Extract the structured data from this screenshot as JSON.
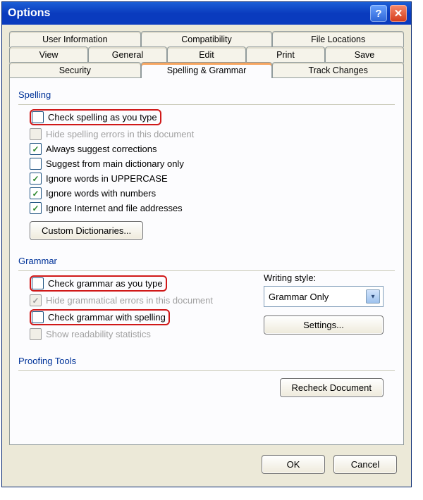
{
  "window": {
    "title": "Options"
  },
  "tabs": {
    "row1": [
      "User Information",
      "Compatibility",
      "File Locations"
    ],
    "row2": [
      "View",
      "General",
      "Edit",
      "Print",
      "Save"
    ],
    "row3": [
      "Security",
      "Spelling & Grammar",
      "Track Changes"
    ],
    "active": "Spelling & Grammar"
  },
  "sections": {
    "spelling": {
      "title": "Spelling"
    },
    "grammar": {
      "title": "Grammar"
    },
    "proofing": {
      "title": "Proofing Tools"
    }
  },
  "spelling_opts": {
    "check_as_type": "Check spelling as you type",
    "hide_errors": "Hide spelling errors in this document",
    "always_suggest": "Always suggest corrections",
    "main_dict_only": "Suggest from main dictionary only",
    "ignore_upper": "Ignore words in UPPERCASE",
    "ignore_numbers": "Ignore words with numbers",
    "ignore_internet": "Ignore Internet and file addresses",
    "custom_dict_btn": "Custom Dictionaries..."
  },
  "grammar_opts": {
    "check_as_type": "Check grammar as you type",
    "hide_errors": "Hide grammatical errors in this document",
    "with_spelling": "Check grammar with spelling",
    "readability": "Show readability statistics",
    "writing_style_label": "Writing style:",
    "writing_style_value": "Grammar Only",
    "settings_btn": "Settings..."
  },
  "proofing": {
    "recheck_btn": "Recheck Document"
  },
  "footer": {
    "ok": "OK",
    "cancel": "Cancel"
  }
}
